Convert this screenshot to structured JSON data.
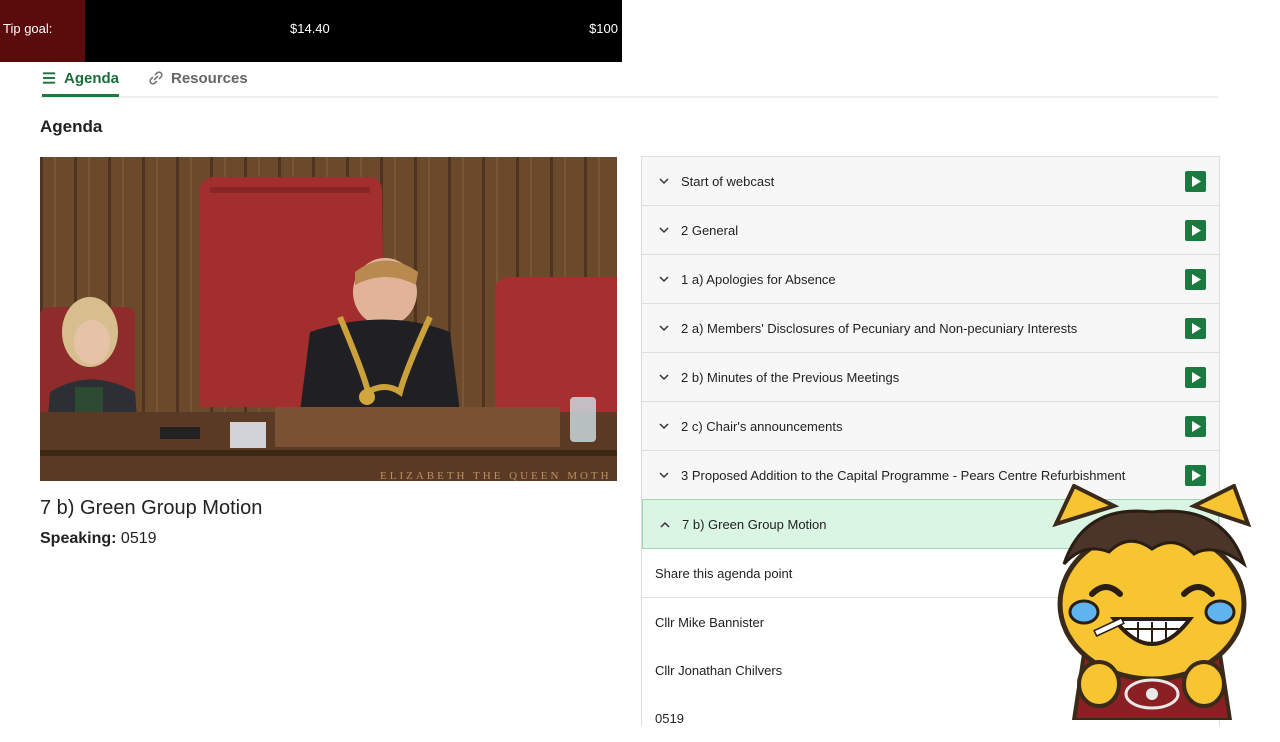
{
  "tip": {
    "label": "Tip goal:",
    "current": "$14.40",
    "target": "$100",
    "progress_fraction": 0.144
  },
  "tabs": {
    "agenda": "Agenda",
    "resources": "Resources"
  },
  "section_title": "Agenda",
  "now": {
    "title": "7 b) Green Group Motion",
    "speaking_label": "Speaking:",
    "speaking_value": "0519"
  },
  "video": {
    "caption": "ELIZABETH THE QUEEN MOTH"
  },
  "agenda": {
    "items": [
      {
        "label": "Start of webcast"
      },
      {
        "label": "2 General"
      },
      {
        "label": "1 a) Apologies for Absence"
      },
      {
        "label": "2 a) Members' Disclosures of Pecuniary and Non-pecuniary Interests"
      },
      {
        "label": "2 b) Minutes of the Previous Meetings"
      },
      {
        "label": "2 c) Chair's announcements"
      },
      {
        "label": "3 Proposed Addition to the Capital Programme - Pears Centre Refurbishment"
      },
      {
        "label": "7 b) Green Group Motion"
      }
    ],
    "share": "Share this agenda point",
    "speakers": [
      "Cllr Mike Bannister",
      "Cllr Jonathan Chilvers",
      "0519"
    ]
  },
  "colors": {
    "accent": "#1a7a3f",
    "active_bg": "#dbf5e4",
    "tip_fill": "#5a0b0b"
  }
}
